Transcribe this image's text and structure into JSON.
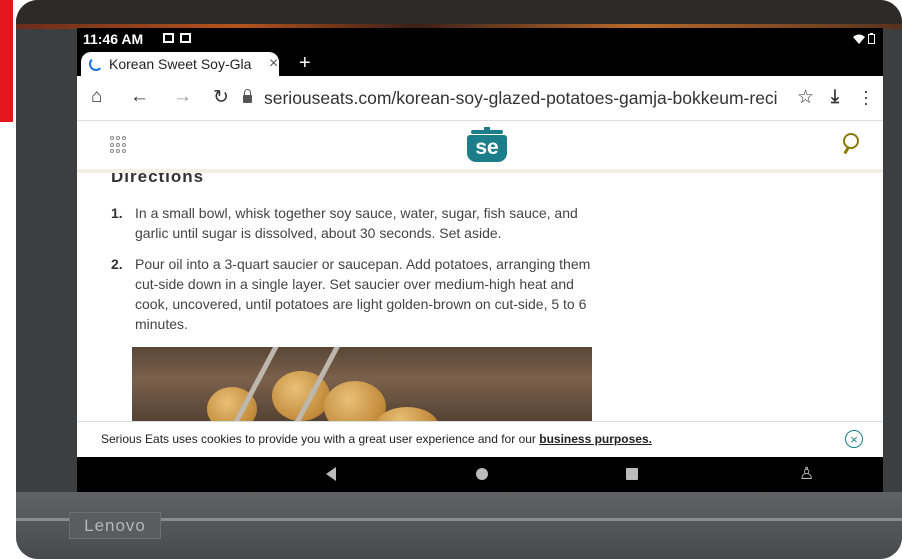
{
  "device": {
    "brand_label": "Lenovo"
  },
  "status_bar": {
    "time": "11:46 AM",
    "left_icons": [
      "message-icon",
      "image-icon"
    ],
    "right_icons": [
      "wifi-icon",
      "battery-icon"
    ]
  },
  "browser": {
    "tab": {
      "title": "Korean Sweet Soy-Gla",
      "close": "×"
    },
    "new_tab": "+",
    "url": "seriouseats.com/korean-soy-glazed-potatoes-gamja-bokkeum-reci",
    "icons": [
      "home-icon",
      "back-icon",
      "forward-icon",
      "reload-icon",
      "lock-icon",
      "star-icon",
      "download-icon",
      "menu-icon"
    ]
  },
  "site_header": {
    "logo_text": "se"
  },
  "article": {
    "heading": "Directions",
    "steps": [
      {
        "number": "1.",
        "text": "In a small bowl, whisk together soy sauce, water, sugar, fish sauce, and garlic until sugar is dissolved, about 30 seconds. Set aside."
      },
      {
        "number": "2.",
        "text": "Pour oil into a 3-quart saucier or saucepan. Add potatoes, arranging them cut-side down in a single layer. Set saucier over medium-high heat and cook, uncovered, until potatoes are light golden-brown on cut-side, 5 to 6 minutes."
      }
    ]
  },
  "cookie_banner": {
    "message": "Serious Eats uses cookies to provide you with a great user experience and for our ",
    "link": "business purposes.",
    "close": "×"
  },
  "android_nav": [
    "back-button",
    "home-button",
    "recents-button",
    "accessibility-button"
  ],
  "colors": {
    "accent": "#1b7e8a",
    "red_bar": "#e4161b"
  }
}
